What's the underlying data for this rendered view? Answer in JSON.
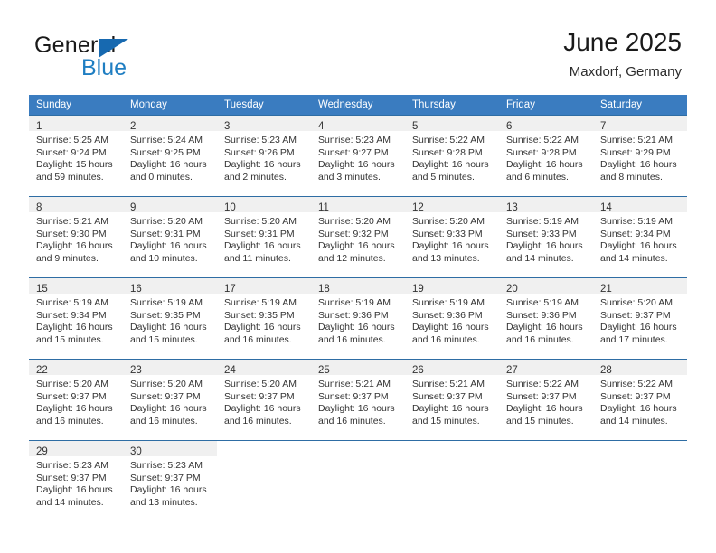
{
  "brand": {
    "name_top": "General",
    "name_bottom": "Blue",
    "flag_icon": "triangle-flag-icon",
    "accent_color": "#1f7ec2"
  },
  "header": {
    "title": "June 2025",
    "subtitle": "Maxdorf, Germany"
  },
  "theme": {
    "header_bg": "#3a7cc0",
    "row_border": "#2e6da4",
    "daynum_bg": "#f0f0f0",
    "text": "#333333"
  },
  "calendar": {
    "weekday_headers": [
      "Sunday",
      "Monday",
      "Tuesday",
      "Wednesday",
      "Thursday",
      "Friday",
      "Saturday"
    ],
    "weeks": [
      [
        {
          "day": "1",
          "sunrise": "Sunrise: 5:25 AM",
          "sunset": "Sunset: 9:24 PM",
          "daylight_line1": "Daylight: 15 hours",
          "daylight_line2": "and 59 minutes."
        },
        {
          "day": "2",
          "sunrise": "Sunrise: 5:24 AM",
          "sunset": "Sunset: 9:25 PM",
          "daylight_line1": "Daylight: 16 hours",
          "daylight_line2": "and 0 minutes."
        },
        {
          "day": "3",
          "sunrise": "Sunrise: 5:23 AM",
          "sunset": "Sunset: 9:26 PM",
          "daylight_line1": "Daylight: 16 hours",
          "daylight_line2": "and 2 minutes."
        },
        {
          "day": "4",
          "sunrise": "Sunrise: 5:23 AM",
          "sunset": "Sunset: 9:27 PM",
          "daylight_line1": "Daylight: 16 hours",
          "daylight_line2": "and 3 minutes."
        },
        {
          "day": "5",
          "sunrise": "Sunrise: 5:22 AM",
          "sunset": "Sunset: 9:28 PM",
          "daylight_line1": "Daylight: 16 hours",
          "daylight_line2": "and 5 minutes."
        },
        {
          "day": "6",
          "sunrise": "Sunrise: 5:22 AM",
          "sunset": "Sunset: 9:28 PM",
          "daylight_line1": "Daylight: 16 hours",
          "daylight_line2": "and 6 minutes."
        },
        {
          "day": "7",
          "sunrise": "Sunrise: 5:21 AM",
          "sunset": "Sunset: 9:29 PM",
          "daylight_line1": "Daylight: 16 hours",
          "daylight_line2": "and 8 minutes."
        }
      ],
      [
        {
          "day": "8",
          "sunrise": "Sunrise: 5:21 AM",
          "sunset": "Sunset: 9:30 PM",
          "daylight_line1": "Daylight: 16 hours",
          "daylight_line2": "and 9 minutes."
        },
        {
          "day": "9",
          "sunrise": "Sunrise: 5:20 AM",
          "sunset": "Sunset: 9:31 PM",
          "daylight_line1": "Daylight: 16 hours",
          "daylight_line2": "and 10 minutes."
        },
        {
          "day": "10",
          "sunrise": "Sunrise: 5:20 AM",
          "sunset": "Sunset: 9:31 PM",
          "daylight_line1": "Daylight: 16 hours",
          "daylight_line2": "and 11 minutes."
        },
        {
          "day": "11",
          "sunrise": "Sunrise: 5:20 AM",
          "sunset": "Sunset: 9:32 PM",
          "daylight_line1": "Daylight: 16 hours",
          "daylight_line2": "and 12 minutes."
        },
        {
          "day": "12",
          "sunrise": "Sunrise: 5:20 AM",
          "sunset": "Sunset: 9:33 PM",
          "daylight_line1": "Daylight: 16 hours",
          "daylight_line2": "and 13 minutes."
        },
        {
          "day": "13",
          "sunrise": "Sunrise: 5:19 AM",
          "sunset": "Sunset: 9:33 PM",
          "daylight_line1": "Daylight: 16 hours",
          "daylight_line2": "and 14 minutes."
        },
        {
          "day": "14",
          "sunrise": "Sunrise: 5:19 AM",
          "sunset": "Sunset: 9:34 PM",
          "daylight_line1": "Daylight: 16 hours",
          "daylight_line2": "and 14 minutes."
        }
      ],
      [
        {
          "day": "15",
          "sunrise": "Sunrise: 5:19 AM",
          "sunset": "Sunset: 9:34 PM",
          "daylight_line1": "Daylight: 16 hours",
          "daylight_line2": "and 15 minutes."
        },
        {
          "day": "16",
          "sunrise": "Sunrise: 5:19 AM",
          "sunset": "Sunset: 9:35 PM",
          "daylight_line1": "Daylight: 16 hours",
          "daylight_line2": "and 15 minutes."
        },
        {
          "day": "17",
          "sunrise": "Sunrise: 5:19 AM",
          "sunset": "Sunset: 9:35 PM",
          "daylight_line1": "Daylight: 16 hours",
          "daylight_line2": "and 16 minutes."
        },
        {
          "day": "18",
          "sunrise": "Sunrise: 5:19 AM",
          "sunset": "Sunset: 9:36 PM",
          "daylight_line1": "Daylight: 16 hours",
          "daylight_line2": "and 16 minutes."
        },
        {
          "day": "19",
          "sunrise": "Sunrise: 5:19 AM",
          "sunset": "Sunset: 9:36 PM",
          "daylight_line1": "Daylight: 16 hours",
          "daylight_line2": "and 16 minutes."
        },
        {
          "day": "20",
          "sunrise": "Sunrise: 5:19 AM",
          "sunset": "Sunset: 9:36 PM",
          "daylight_line1": "Daylight: 16 hours",
          "daylight_line2": "and 16 minutes."
        },
        {
          "day": "21",
          "sunrise": "Sunrise: 5:20 AM",
          "sunset": "Sunset: 9:37 PM",
          "daylight_line1": "Daylight: 16 hours",
          "daylight_line2": "and 17 minutes."
        }
      ],
      [
        {
          "day": "22",
          "sunrise": "Sunrise: 5:20 AM",
          "sunset": "Sunset: 9:37 PM",
          "daylight_line1": "Daylight: 16 hours",
          "daylight_line2": "and 16 minutes."
        },
        {
          "day": "23",
          "sunrise": "Sunrise: 5:20 AM",
          "sunset": "Sunset: 9:37 PM",
          "daylight_line1": "Daylight: 16 hours",
          "daylight_line2": "and 16 minutes."
        },
        {
          "day": "24",
          "sunrise": "Sunrise: 5:20 AM",
          "sunset": "Sunset: 9:37 PM",
          "daylight_line1": "Daylight: 16 hours",
          "daylight_line2": "and 16 minutes."
        },
        {
          "day": "25",
          "sunrise": "Sunrise: 5:21 AM",
          "sunset": "Sunset: 9:37 PM",
          "daylight_line1": "Daylight: 16 hours",
          "daylight_line2": "and 16 minutes."
        },
        {
          "day": "26",
          "sunrise": "Sunrise: 5:21 AM",
          "sunset": "Sunset: 9:37 PM",
          "daylight_line1": "Daylight: 16 hours",
          "daylight_line2": "and 15 minutes."
        },
        {
          "day": "27",
          "sunrise": "Sunrise: 5:22 AM",
          "sunset": "Sunset: 9:37 PM",
          "daylight_line1": "Daylight: 16 hours",
          "daylight_line2": "and 15 minutes."
        },
        {
          "day": "28",
          "sunrise": "Sunrise: 5:22 AM",
          "sunset": "Sunset: 9:37 PM",
          "daylight_line1": "Daylight: 16 hours",
          "daylight_line2": "and 14 minutes."
        }
      ],
      [
        {
          "day": "29",
          "sunrise": "Sunrise: 5:23 AM",
          "sunset": "Sunset: 9:37 PM",
          "daylight_line1": "Daylight: 16 hours",
          "daylight_line2": "and 14 minutes."
        },
        {
          "day": "30",
          "sunrise": "Sunrise: 5:23 AM",
          "sunset": "Sunset: 9:37 PM",
          "daylight_line1": "Daylight: 16 hours",
          "daylight_line2": "and 13 minutes."
        },
        null,
        null,
        null,
        null,
        null
      ]
    ]
  }
}
